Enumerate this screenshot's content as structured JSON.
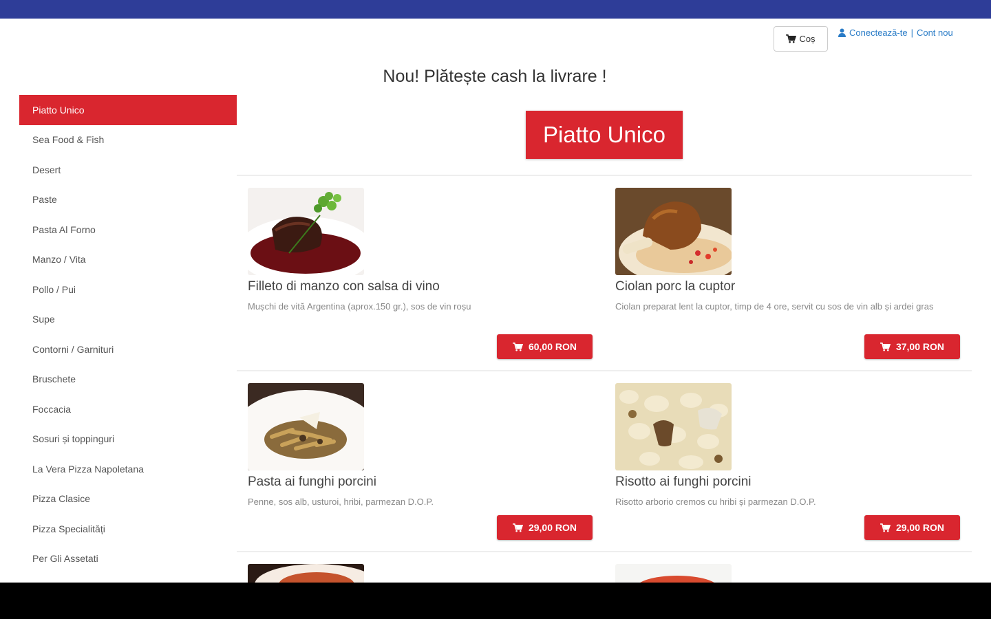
{
  "header": {
    "cart_label": "Coș",
    "login_label": "Conectează-te",
    "separator": "|",
    "register_label": "Cont nou"
  },
  "promo_text": "Nou! Plătește cash la livrare !",
  "sidebar": {
    "items": [
      {
        "label": "Piatto Unico",
        "active": true
      },
      {
        "label": "Sea Food & Fish"
      },
      {
        "label": "Desert"
      },
      {
        "label": "Paste"
      },
      {
        "label": "Pasta Al Forno"
      },
      {
        "label": "Manzo / Vita"
      },
      {
        "label": "Pollo / Pui"
      },
      {
        "label": "Supe"
      },
      {
        "label": "Contorni / Garnituri"
      },
      {
        "label": "Bruschete"
      },
      {
        "label": "Foccacia"
      },
      {
        "label": "Sosuri și toppinguri"
      },
      {
        "label": "La Vera Pizza Napoletana"
      },
      {
        "label": "Pizza Clasice"
      },
      {
        "label": "Pizza Specialități"
      },
      {
        "label": "Per Gli Assetati"
      }
    ]
  },
  "section_title": "Piatto Unico",
  "products": [
    {
      "name": "Filleto di manzo con salsa di vino",
      "description": "Mușchi de vită Argentina (aprox.150 gr.), sos de vin roșu",
      "price": "60,00 RON",
      "image_icon": "beef-steak-photo"
    },
    {
      "name": "Ciolan porc la cuptor",
      "description": "Ciolan preparat lent la cuptor, timp de 4 ore, servit cu sos de vin alb și ardei gras",
      "price": "37,00 RON",
      "image_icon": "pork-knuckle-photo"
    },
    {
      "name": "Pasta ai funghi porcini",
      "description": "Penne, sos alb, usturoi, hribi, parmezan D.O.P.",
      "price": "29,00 RON",
      "image_icon": "pasta-photo"
    },
    {
      "name": "Risotto ai funghi porcini",
      "description": "Risotto arborio cremos cu hribi și parmezan D.O.P.",
      "price": "29,00 RON",
      "image_icon": "risotto-photo"
    }
  ],
  "colors": {
    "top_bar": "#2e3d98",
    "accent_red": "#d9262f",
    "link_blue": "#2a7cc7"
  }
}
